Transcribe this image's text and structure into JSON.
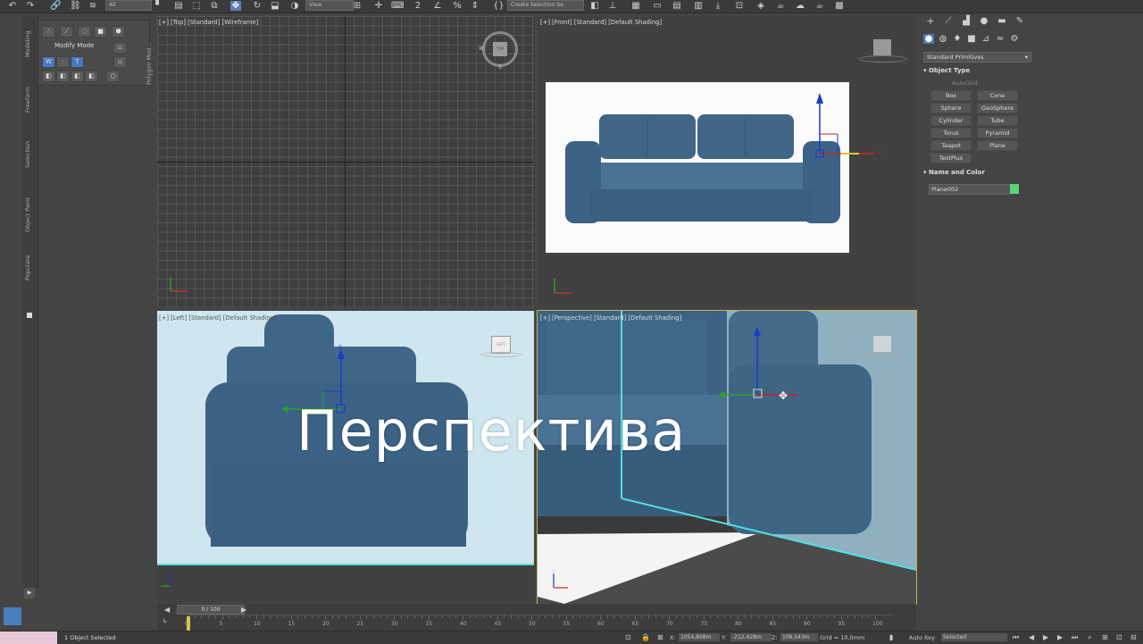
{
  "toolbar": {
    "selection_filter": "All",
    "view_dropdown": "View",
    "selection_set": "Create Selection Se"
  },
  "left_tabs": {
    "modeling": "Modeling",
    "freeform": "Freeform",
    "selection": "Selection",
    "object_paint": "Object Paint",
    "populate": "Populate"
  },
  "ribbon": {
    "modify_mode": "Modify Mode",
    "polygon_modeling": "Polygon Mod..."
  },
  "viewports": {
    "top": "[+] [Top] [Standard] [Wireframe]",
    "front": "[+] [Front] [Standard] [Default Shading]",
    "left": "[+] [Left] [Standard] [Default Shading]",
    "perspective": "[+] [Perspective] [Standard] [Default Shading]"
  },
  "viewcube": {
    "top": "TOP",
    "left": "LEFT",
    "west": "W",
    "south": "S"
  },
  "gizmo_axes": {
    "x": "x",
    "y": "y",
    "z": "z"
  },
  "overlay_caption": "Перспектива",
  "command_panel": {
    "dropdown": "Standard Primitives",
    "object_type_header": "Object Type",
    "autogrid": "AutoGrid",
    "buttons": [
      "Box",
      "Cone",
      "Sphere",
      "GeoSphere",
      "Cylinder",
      "Tube",
      "Torus",
      "Pyramid",
      "Teapot",
      "Plane",
      "TextPlus"
    ],
    "name_color_header": "Name and Color",
    "object_name": "Plane002",
    "object_color": "#5ad47a"
  },
  "timeline": {
    "frame_counter": "0 / 100",
    "ticks": [
      "0",
      "5",
      "10",
      "15",
      "20",
      "25",
      "30",
      "35",
      "40",
      "45",
      "50",
      "55",
      "60",
      "65",
      "70",
      "75",
      "80",
      "85",
      "90",
      "95",
      "100"
    ]
  },
  "status": {
    "selected": "1 Object Selected",
    "x_label": "X:",
    "x_value": "1054,808m",
    "y_label": "Y:",
    "y_value": "-212,428m",
    "z_label": "Z:",
    "z_value": "106,543m",
    "grid": "Grid = 10,0mm",
    "auto_key": "Auto Key",
    "key_mode": "Selected"
  }
}
